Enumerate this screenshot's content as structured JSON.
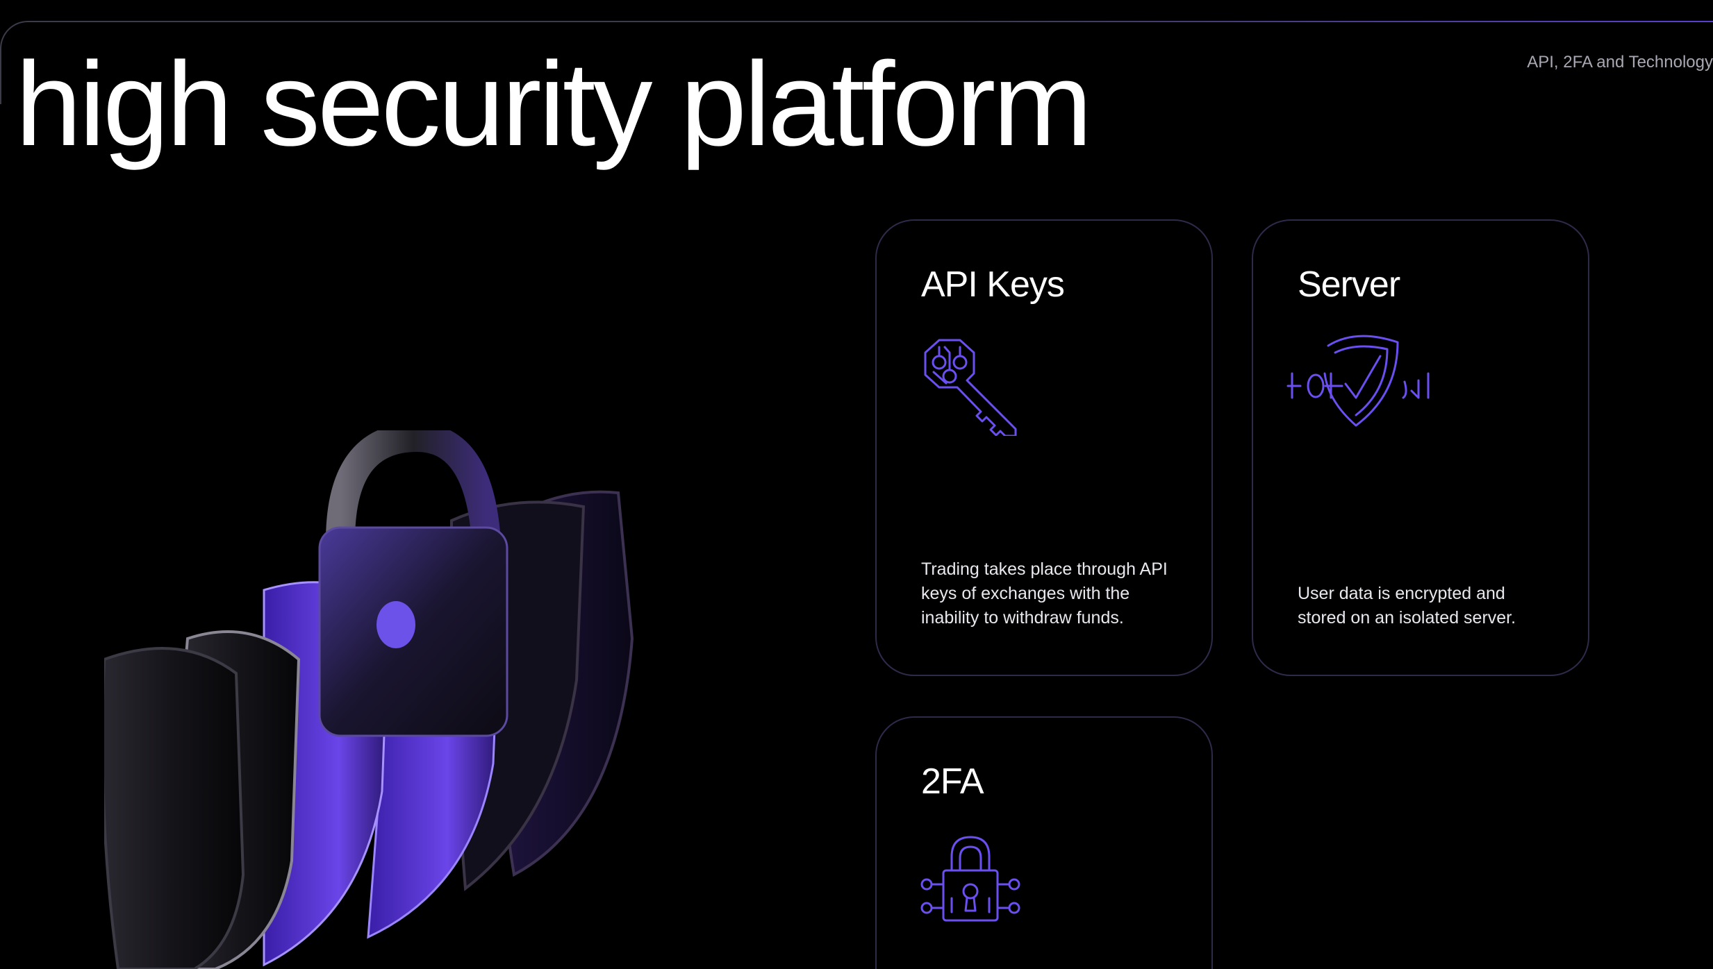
{
  "header": {
    "title": "high security platform",
    "section_tag": "API, 2FA and Technology"
  },
  "hero": {
    "image": "padlock-shields-illustration"
  },
  "cards": [
    {
      "title": "API Keys",
      "icon": "key-circuit-icon",
      "description": "Trading takes place through API keys of exchanges with the inability to withdraw funds."
    },
    {
      "title": "Server",
      "icon": "shield-binary-icon",
      "description": "User data is encrypted and stored on an isolated server."
    },
    {
      "title": "2FA",
      "icon": "padlock-circuit-icon",
      "description": ""
    }
  ],
  "colors": {
    "background": "#000000",
    "accent": "#6b4ff0",
    "card_border": "#2e2a4a",
    "muted_text": "#a8a8b4"
  }
}
